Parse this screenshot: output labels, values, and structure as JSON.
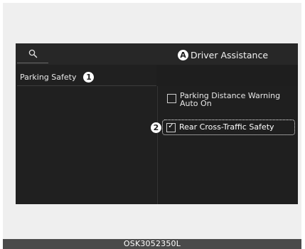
{
  "header": {
    "marker": "A",
    "title": "Driver Assistance",
    "search_icon": "search-icon"
  },
  "sidebar": {
    "items": [
      {
        "label": "Parking Safety",
        "marker": "1"
      }
    ]
  },
  "options": [
    {
      "label_line1": "Parking Distance Warning",
      "label_line2": "Auto On",
      "checked": false
    },
    {
      "label": "Rear Cross-Traffic Safety",
      "checked": true,
      "marker": "2",
      "check_icon": "checkmark-icon"
    }
  ],
  "caption": "OSK3052350L",
  "colors": {
    "screen_bg": "#1e1e1e",
    "highlight_border": "#ffffff",
    "caption_bar": "#4a4a4a"
  }
}
